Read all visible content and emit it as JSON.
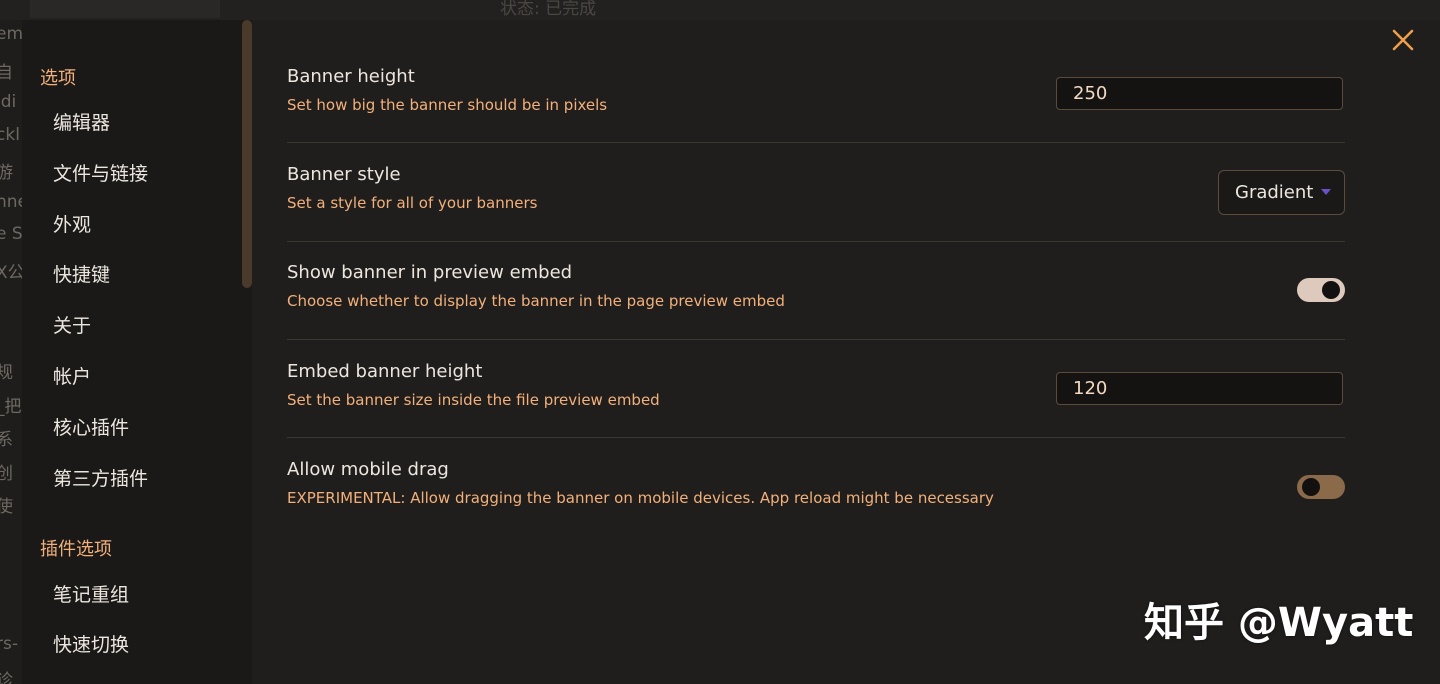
{
  "background": {
    "status_text": "状态: 已完成",
    "sliver_texts": [
      "em",
      "自",
      "idi",
      "ckl",
      "游",
      "nne",
      "e Se",
      "X公",
      "规",
      "_把",
      "系",
      "创",
      "使",
      "rs-",
      "诊"
    ]
  },
  "sidebar": {
    "options_heading": "选项",
    "options_items": [
      {
        "label": "编辑器"
      },
      {
        "label": "文件与链接"
      },
      {
        "label": "外观"
      },
      {
        "label": "快捷键"
      },
      {
        "label": "关于"
      },
      {
        "label": "帐户"
      },
      {
        "label": "核心插件"
      },
      {
        "label": "第三方插件"
      }
    ],
    "plugin_heading": "插件选项",
    "plugin_items": [
      {
        "label": "笔记重组"
      },
      {
        "label": "快速切换"
      }
    ]
  },
  "settings": [
    {
      "name": "Banner height",
      "desc": "Set how big the banner should be in pixels",
      "control": "text",
      "value": "250"
    },
    {
      "name": "Banner style",
      "desc": "Set a style for all of your banners",
      "control": "dropdown",
      "value": "Gradient"
    },
    {
      "name": "Show banner in preview embed",
      "desc": "Choose whether to display the banner in the page preview embed",
      "control": "toggle",
      "enabled": true
    },
    {
      "name": "Embed banner height",
      "desc": "Set the banner size inside the file preview embed",
      "control": "text",
      "value": "120"
    },
    {
      "name": "Allow mobile drag",
      "desc": "EXPERIMENTAL: Allow dragging the banner on mobile devices. App reload might be necessary",
      "control": "toggle",
      "enabled": false
    }
  ],
  "close_icon": "close-icon",
  "watermark": "知乎 @Wyatt",
  "colors": {
    "accent_text": "#f2b07a",
    "toggle_on": "#ddcabd",
    "toggle_off": "#8a6a48",
    "dropdown_caret": "#6b4fc9",
    "close": "#f0a04b"
  }
}
